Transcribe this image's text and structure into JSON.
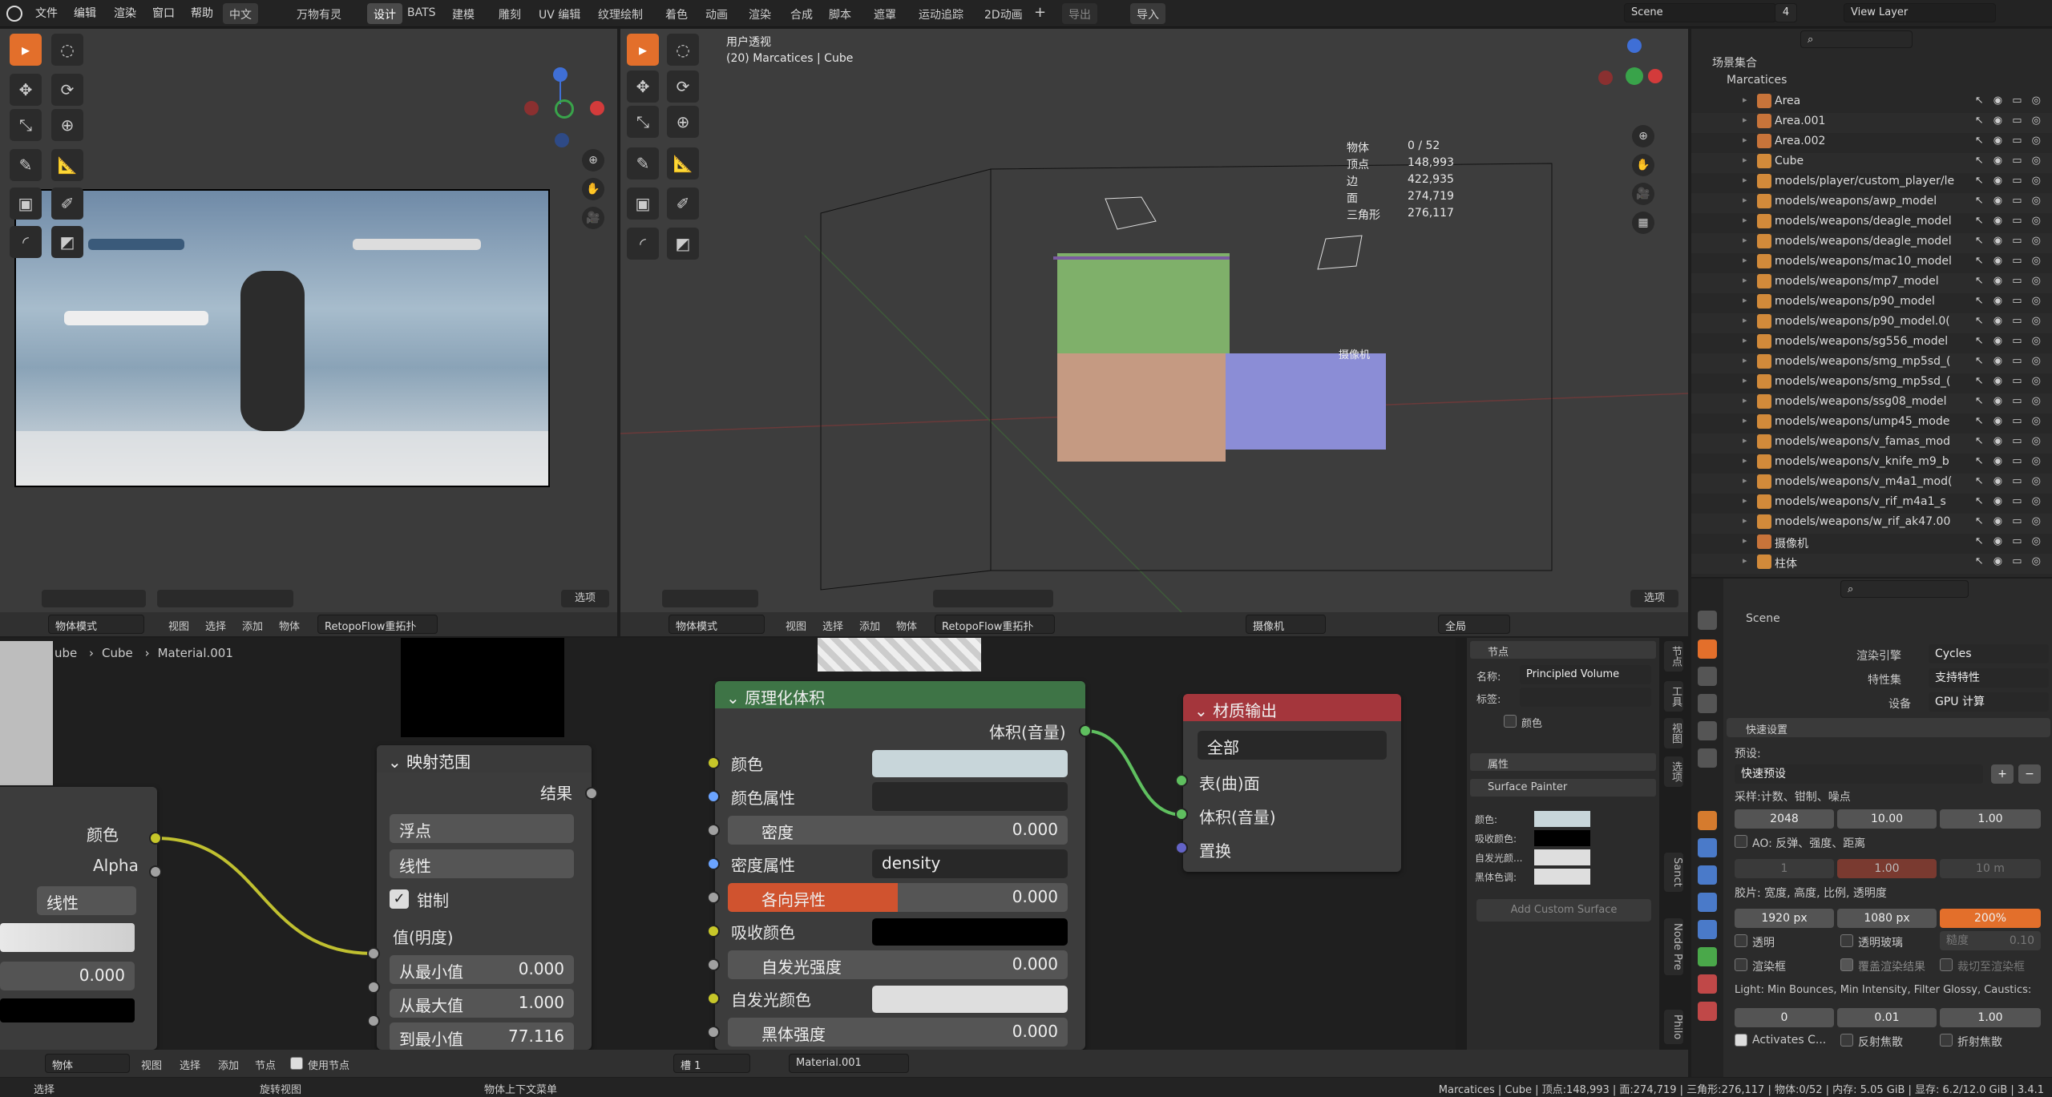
{
  "menu": {
    "file": "文件",
    "edit": "编辑",
    "render": "渲染",
    "window": "窗口",
    "help": "帮助",
    "lang": "中文"
  },
  "workspaces": [
    "万物有灵",
    "设计",
    "BATS",
    "建模",
    "雕刻",
    "UV 编辑",
    "纹理绘制",
    "着色",
    "动画",
    "渲染",
    "合成",
    "脚本",
    "遮罩",
    "运动追踪",
    "2D动画"
  ],
  "topright": {
    "export": "导出",
    "import": "导入",
    "scene": "Scene",
    "scene_count": "4",
    "view_layer": "View Layer"
  },
  "viewport": {
    "title": "用户透视",
    "subtitle": "(20) Marcatices | Cube",
    "stats": [
      [
        "物体",
        "0 / 52"
      ],
      [
        "顶点",
        "148,993"
      ],
      [
        "边",
        "422,935"
      ],
      [
        "面",
        "274,719"
      ],
      [
        "三角形",
        "276,117"
      ]
    ],
    "camera_label": "摄像机"
  },
  "vp_header": {
    "mode": "物体模式",
    "view": "视图",
    "select": "选择",
    "add": "添加",
    "object": "物体",
    "retopo": "RetopoFlow重拓扑",
    "options": "选项",
    "camera": "摄像机",
    "global": "全局"
  },
  "outliner": {
    "root": "场景集合",
    "collection": "Marcatices",
    "items": [
      "Area",
      "Area.001",
      "Area.002",
      "Cube",
      "models/player/custom_player/le",
      "models/weapons/awp_model",
      "models/weapons/deagle_model",
      "models/weapons/deagle_model",
      "models/weapons/mac10_model",
      "models/weapons/mp7_model",
      "models/weapons/p90_model",
      "models/weapons/p90_model.0(",
      "models/weapons/sg556_model",
      "models/weapons/smg_mp5sd_(",
      "models/weapons/smg_mp5sd_(",
      "models/weapons/ssg08_model",
      "models/weapons/ump45_mode",
      "models/weapons/v_famas_mod",
      "models/weapons/v_knife_m9_b",
      "models/weapons/v_m4a1_mod(",
      "models/weapons/v_rif_m4a1_s",
      "models/weapons/w_rif_ak47.00",
      "摄像机",
      "柱体"
    ]
  },
  "properties": {
    "scene": "Scene",
    "engine_label": "渲染引擎",
    "engine": "Cycles",
    "feature_label": "特性集",
    "feature": "支持特性",
    "device_label": "设备",
    "device": "GPU 计算",
    "quick_setup": "快速设置",
    "preset_label": "预设:",
    "preset": "快速预设",
    "sampling_label": "采样:计数、钳制、噪点",
    "samples": [
      "2048",
      "10.00",
      "1.00"
    ],
    "ao_label": "AO: 反弹、强度、距离",
    "ao": [
      "1",
      "1.00",
      "10 m"
    ],
    "res_label": "胶片: 宽度, 高度, 比例, 透明度",
    "res": [
      "1920 px",
      "1080 px",
      "200%"
    ],
    "transparent": "透明",
    "trans_glass": "透明玻璃",
    "roughness": "糙度",
    "roughness_val": "0.10",
    "render_region": "渲染框",
    "overwrite": "覆盖渲染结果",
    "crop": "裁切至渲染框",
    "light_label": "Light: Min Bounces, Min Intensity, Filter Glossy, Caustics:",
    "light": [
      "0",
      "0.01",
      "1.00"
    ],
    "activates": "Activates C...",
    "reflect_caustic": "反射焦散",
    "refract_caustic": "折射焦散"
  },
  "node_editor": {
    "breadcrumb": [
      "ube",
      "Cube",
      "Material.001"
    ],
    "map_range": {
      "title": "映射范围",
      "result": "结果",
      "type": "浮点",
      "interp": "线性",
      "clamp": "钳制",
      "value": "值(明度)",
      "from_min": "从最小值",
      "from_min_v": "0.000",
      "from_max": "从最大值",
      "from_max_v": "1.000",
      "to_min": "到最小值",
      "to_min_v": "77.116"
    },
    "volume": {
      "title": "原理化体积",
      "out": "体积(音量)",
      "color": "颜色",
      "color_attr": "颜色属性",
      "density": "密度",
      "density_v": "0.000",
      "density_attr": "密度属性",
      "density_attr_v": "density",
      "anisotropy": "各向异性",
      "anisotropy_v": "0.000",
      "absorb": "吸收颜色",
      "emit_str": "自发光强度",
      "emit_str_v": "0.000",
      "emit_col": "自发光颜色",
      "blackbody": "黑体强度",
      "blackbody_v": "0.000"
    },
    "output": {
      "title": "材质输出",
      "target": "全部",
      "surface": "表(曲)面",
      "volume": "体积(音量)",
      "displace": "置换"
    },
    "left_node": {
      "color": "颜色",
      "alpha": "Alpha",
      "interp": "线性",
      "value": "0.000"
    },
    "sidebar": {
      "node": "节点",
      "name_label": "名称:",
      "name": "Principled Volume",
      "label_label": "标签:",
      "color": "颜色",
      "props": "属性",
      "sp": "Surface Painter",
      "sp_rows": [
        "颜色:",
        "吸收颜色:",
        "自发光颜...",
        "黑体色调:"
      ],
      "add_surface": "Add Custom Surface"
    },
    "side_tabs": [
      "节点",
      "工具",
      "视图",
      "选项",
      "Sanct",
      "Node Pre",
      "Philo"
    ],
    "footer": {
      "mode": "物体",
      "view": "视图",
      "select": "选择",
      "add": "添加",
      "node": "节点",
      "use_nodes": "使用节点",
      "slot": "槽 1",
      "material": "Material.001"
    }
  },
  "status": {
    "select": "选择",
    "rotate": "旋转视图",
    "ctx": "物体上下文菜单",
    "info": "Marcatices | Cube | 顶点:148,993 | 面:274,719 | 三角形:276,117 | 物体:0/52 | 内存: 5.05 GiB | 显存: 6.2/12.0 GiB | 3.4.1"
  },
  "colors": {
    "accent": "#e36f2b",
    "node_green": "#3e7446",
    "node_red": "#a4363c",
    "socket_yellow": "#c7c729",
    "socket_gray": "#a1a1a1",
    "socket_blue": "#6ba4ff",
    "socket_purple": "#6363c7"
  }
}
